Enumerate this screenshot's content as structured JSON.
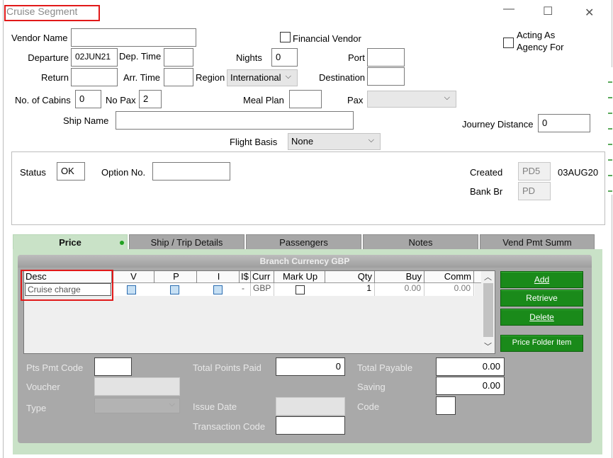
{
  "window": {
    "title": "Cruise Segment",
    "minimize": "—",
    "maximize": "☐",
    "close": "✕"
  },
  "form": {
    "vendor_name": {
      "label": "Vendor Name",
      "value": ""
    },
    "financial_vendor": {
      "label": "Financial Vendor",
      "checked": false
    },
    "acting_as_agency": {
      "label_line1": "Acting As",
      "label_line2": "Agency For",
      "checked": false
    },
    "departure": {
      "label": "Departure",
      "value": "02JUN21"
    },
    "dep_time": {
      "label": "Dep. Time",
      "value": ""
    },
    "nights": {
      "label": "Nights",
      "value": "0"
    },
    "port": {
      "label": "Port",
      "value": ""
    },
    "return": {
      "label": "Return",
      "value": ""
    },
    "arr_time": {
      "label": "Arr. Time",
      "value": ""
    },
    "region": {
      "label": "Region",
      "value": "International"
    },
    "destination": {
      "label": "Destination",
      "value": ""
    },
    "no_of_cabins": {
      "label": "No. of Cabins",
      "value": "0"
    },
    "no_pax": {
      "label": "No Pax",
      "value": "2"
    },
    "meal_plan": {
      "label": "Meal Plan",
      "value": ""
    },
    "pax": {
      "label": "Pax",
      "value": ""
    },
    "ship_name": {
      "label": "Ship Name",
      "value": ""
    },
    "journey_distance": {
      "label": "Journey Distance",
      "value": "0"
    },
    "flight_basis": {
      "label": "Flight Basis",
      "value": "None"
    }
  },
  "status_panel": {
    "status": {
      "label": "Status",
      "value": "OK"
    },
    "option_no": {
      "label": "Option No.",
      "value": ""
    },
    "created": {
      "label": "Created",
      "value": "PD5",
      "date": "03AUG20"
    },
    "bank_br": {
      "label": "Bank Br",
      "value": "PD"
    }
  },
  "tabs": [
    {
      "label": "Price",
      "active": true
    },
    {
      "label": "Ship / Trip Details"
    },
    {
      "label": "Passengers"
    },
    {
      "label": "Notes"
    },
    {
      "label": "Vend Pmt Summ"
    }
  ],
  "price": {
    "header": "Branch Currency GBP",
    "columns": [
      "Desc",
      "V",
      "P",
      "I",
      "I$",
      "Curr",
      "Mark Up",
      "Qty",
      "Buy",
      "Comm"
    ],
    "rows": [
      {
        "desc": "Cruise charge",
        "v": false,
        "p": false,
        "i": false,
        "is": "-",
        "curr": "GBP",
        "markup": false,
        "qty": "1",
        "buy": "0.00",
        "comm": "0.00"
      }
    ],
    "buttons": {
      "add": "Add",
      "retrieve": "Retrieve",
      "delete": "Delete",
      "price_folder_item": "Price Folder Item"
    },
    "pts_pmt_code": {
      "label": "Pts Pmt Code",
      "value": ""
    },
    "voucher": {
      "label": "Voucher",
      "value": ""
    },
    "type": {
      "label": "Type",
      "value": ""
    },
    "total_points_paid": {
      "label": "Total Points Paid",
      "value": "0"
    },
    "issue_date": {
      "label": "Issue Date",
      "value": ""
    },
    "transaction_code": {
      "label": "Transaction Code",
      "value": ""
    },
    "total_payable": {
      "label": "Total Payable",
      "value": "0.00"
    },
    "saving": {
      "label": "Saving",
      "value": "0.00"
    },
    "code": {
      "label": "Code",
      "value": ""
    }
  },
  "colors": {
    "accent_green": "#1a8a1a",
    "tab_active": "#c9e2c7",
    "panel_gray": "#a9a9a9",
    "highlight_red": "#e11919"
  }
}
